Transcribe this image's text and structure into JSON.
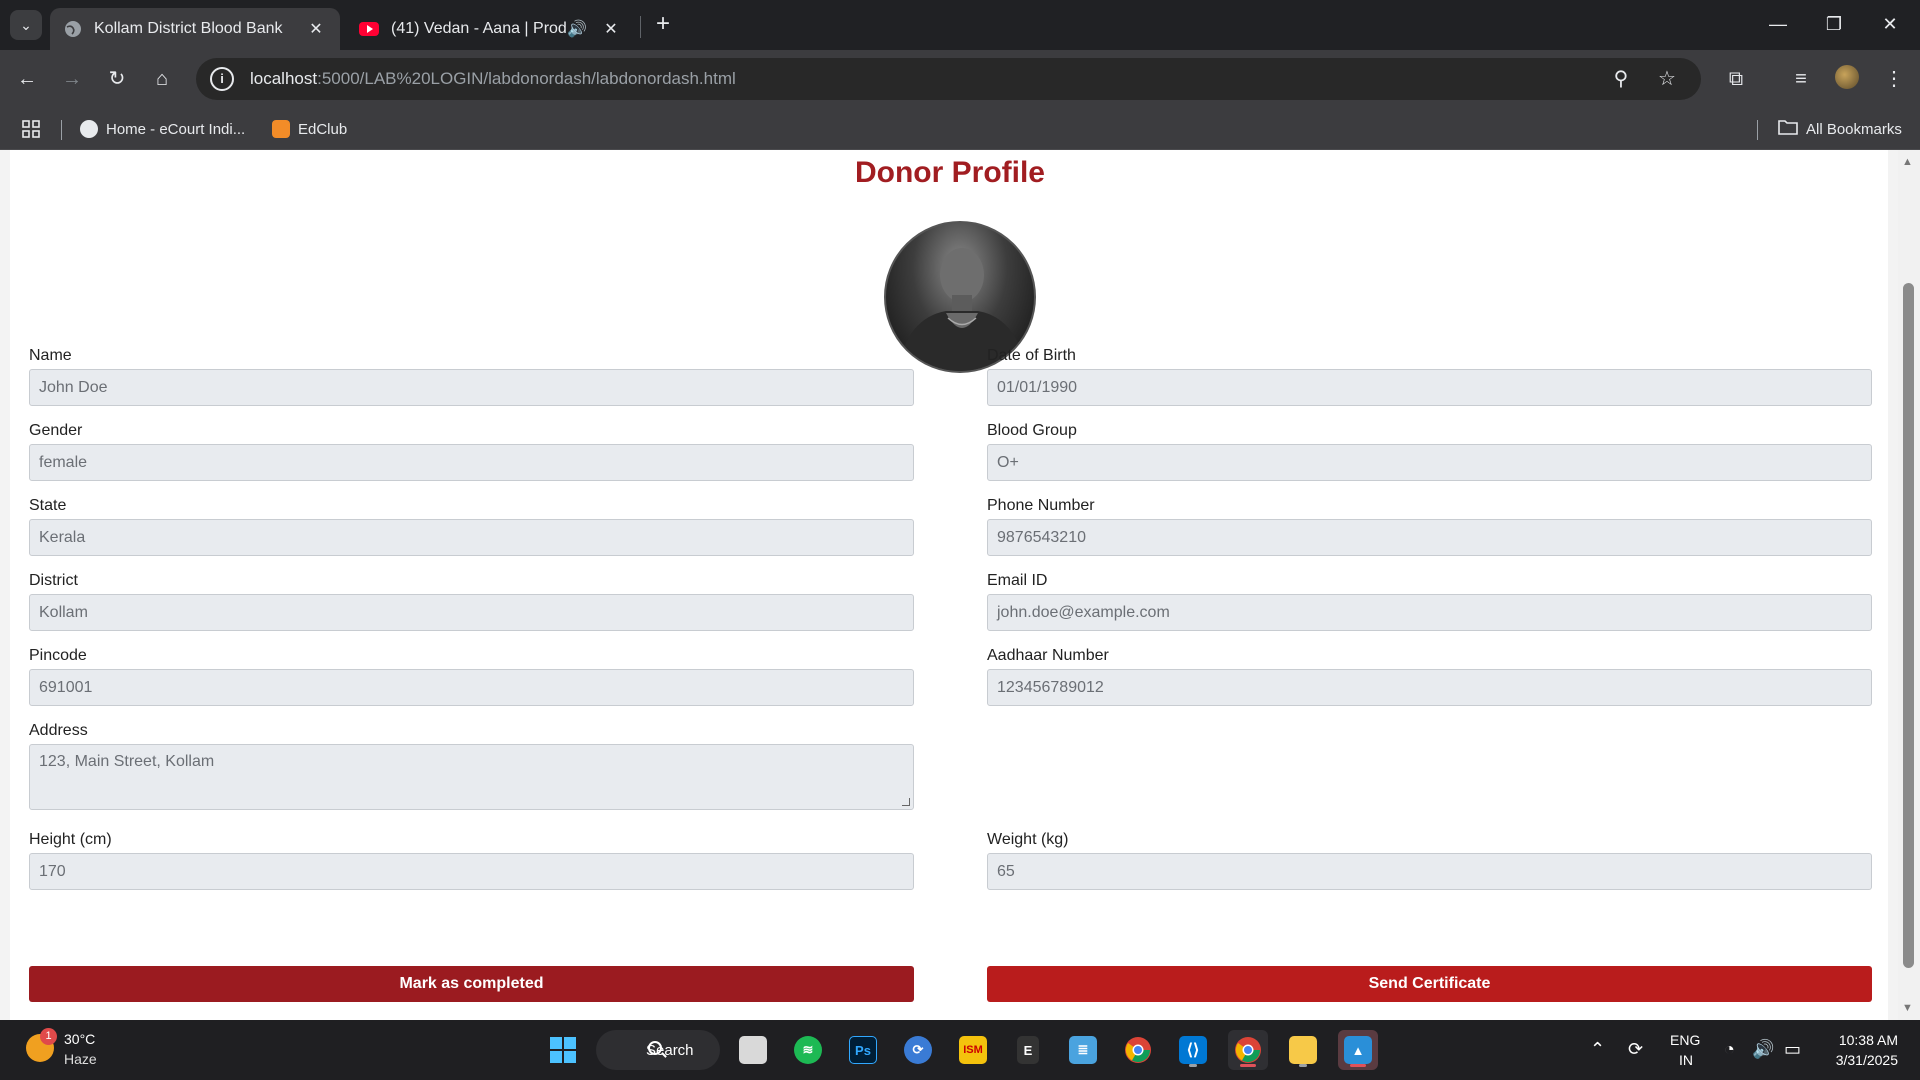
{
  "browser": {
    "tabs": [
      {
        "title": "Kollam District Blood Bank",
        "active": true
      },
      {
        "title": "(41) Vedan - Aana | Prod. @",
        "active": false,
        "audio": true
      }
    ],
    "url_host": "localhost",
    "url_path": ":5000/LAB%20LOGIN/labdonordash/labdonordash.html",
    "bookmarks": [
      {
        "label": "Home - eCourt Indi..."
      },
      {
        "label": "EdClub"
      }
    ],
    "all_bookmarks_label": "All Bookmarks"
  },
  "page": {
    "title": "Donor Profile",
    "photo_alt": "Donor photo",
    "fields": {
      "name": {
        "label": "Name",
        "value": "John Doe"
      },
      "dob": {
        "label": "Date of Birth",
        "value": "01/01/1990"
      },
      "gender": {
        "label": "Gender",
        "value": "female"
      },
      "blood_group": {
        "label": "Blood Group",
        "value": "O+"
      },
      "state": {
        "label": "State",
        "value": "Kerala"
      },
      "phone": {
        "label": "Phone Number",
        "value": "9876543210"
      },
      "district": {
        "label": "District",
        "value": "Kollam"
      },
      "email": {
        "label": "Email ID",
        "value": "john.doe@example.com"
      },
      "pincode": {
        "label": "Pincode",
        "value": "691001"
      },
      "aadhaar": {
        "label": "Aadhaar Number",
        "value": "123456789012"
      },
      "address": {
        "label": "Address",
        "value": "123, Main Street, Kollam"
      },
      "height": {
        "label": "Height (cm)",
        "value": "170"
      },
      "weight": {
        "label": "Weight (kg)",
        "value": "65"
      }
    },
    "buttons": {
      "mark_completed": "Mark as completed",
      "send_certificate": "Send Certificate"
    }
  },
  "taskbar": {
    "weather_temp": "30°C",
    "weather_desc": "Haze",
    "weather_badge": "1",
    "search_label": "Search",
    "lang_top": "ENG",
    "lang_bottom": "IN",
    "time": "10:38 AM",
    "date": "3/31/2025"
  },
  "colors": {
    "title_red": "#a11d21",
    "button_dark_red": "#9b1b20",
    "button_red": "#b91c1c"
  }
}
